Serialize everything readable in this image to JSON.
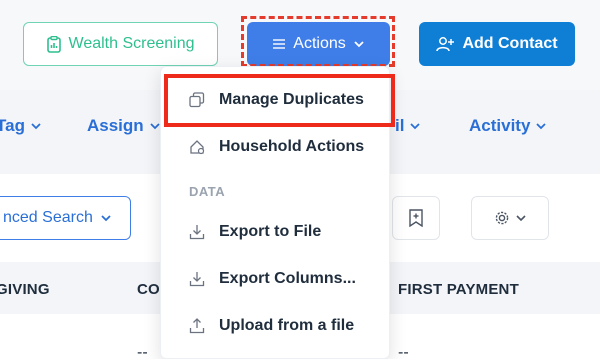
{
  "toolbar": {
    "wealth_label": "Wealth Screening",
    "actions_label": "Actions",
    "add_contact_label": "Add Contact"
  },
  "filters": {
    "tag": "Tag",
    "assign": "Assign",
    "email": "il",
    "activity": "Activity"
  },
  "search": {
    "advanced_label": "nced Search"
  },
  "table": {
    "headers": [
      "GIVING",
      "CO",
      "FIRST PAYMENT"
    ],
    "cells": [
      "--",
      "--"
    ]
  },
  "dropdown": {
    "items": [
      {
        "label": "Manage Duplicates",
        "icon": "duplicate-icon"
      },
      {
        "label": "Household Actions",
        "icon": "house-icon"
      }
    ],
    "section": "DATA",
    "data_items": [
      {
        "label": "Export to File",
        "icon": "download-icon"
      },
      {
        "label": "Export Columns...",
        "icon": "download-icon"
      },
      {
        "label": "Upload from a file",
        "icon": "upload-icon"
      }
    ]
  },
  "colors": {
    "primary": "#3f7ee8",
    "add_contact": "#0f7fd6",
    "wealth_green": "#2fbf8f",
    "highlight_red": "#e43b2c"
  }
}
